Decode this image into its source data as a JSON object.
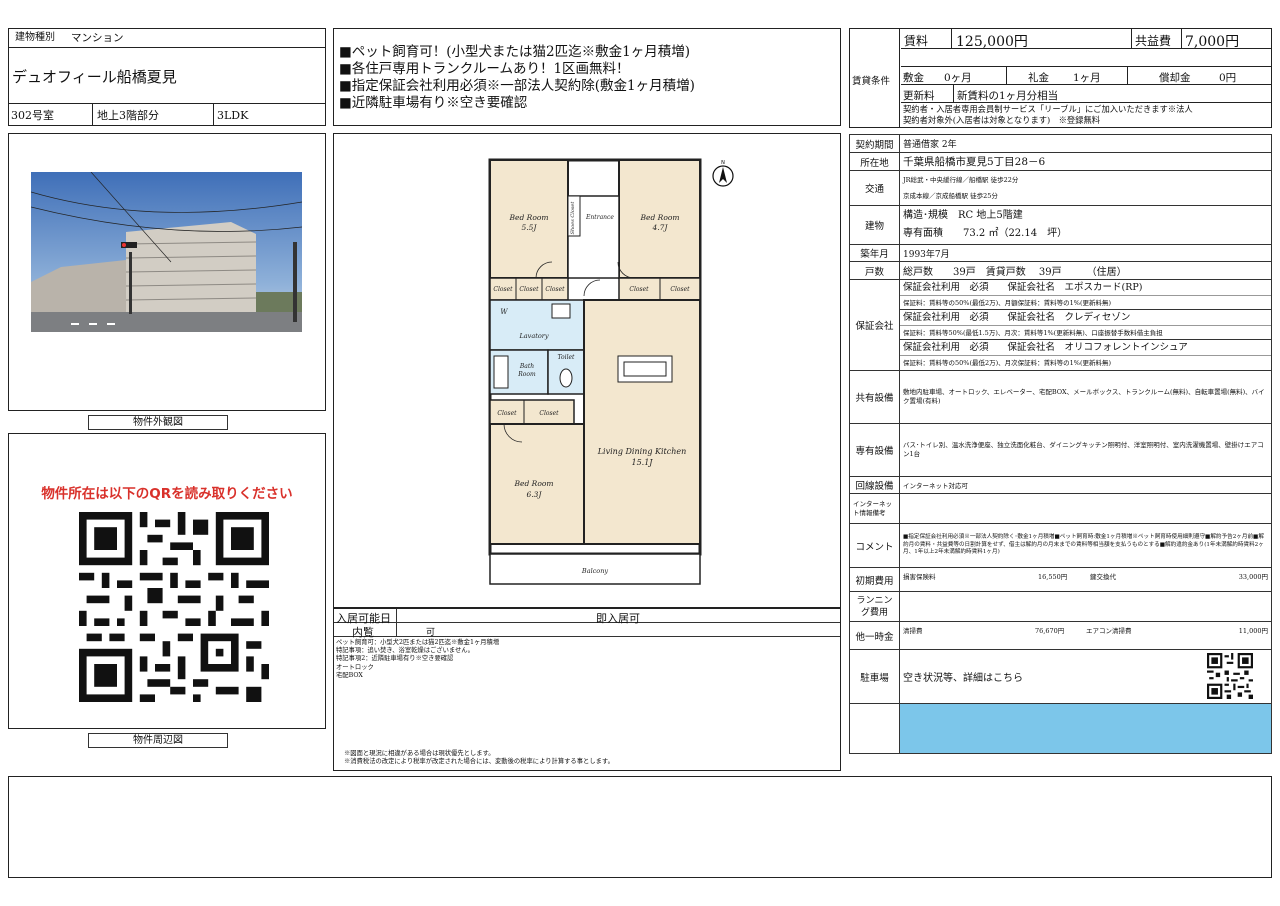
{
  "property": {
    "type_label": "建物種別",
    "type_value": "マンション",
    "name": "デュオフィール船橋夏見",
    "room": "302号室",
    "floor": "地上3階部分",
    "layout": "3LDK"
  },
  "captions": {
    "photo": "物件外観図",
    "map": "物件周辺図"
  },
  "qr_notice": "物件所在は以下のQRを読み取りください",
  "remarks": [
    "■ペット飼育可！(小型犬または猫2匹迄※敷金1ヶ月積増)",
    "■各住戸専用トランクルームあり！1区画無料！",
    "■指定保証会社利用必須※一部法人契約除(敷金1ヶ月積増)",
    "■近隣駐車場有り※空き要確認"
  ],
  "floorplan": {
    "rooms": {
      "bed1": "Bed Room\n5.5J",
      "bed2": "Bed Room\n4.7J",
      "bed3": "Bed Room\n6.3J",
      "ldk": "Living Dining Kitchen\n15.1J",
      "entrance": "Entrance",
      "shoes": "Shoes Closet",
      "lavatory": "Lavatory",
      "bath": "Bath Room",
      "toilet": "Toilet",
      "closet": "Closet",
      "balcony": "Balcony",
      "w": "W"
    }
  },
  "movein": {
    "label": "入居可能日",
    "value": "即入居可",
    "viewing_label": "内覧",
    "viewing_value": "可",
    "notes": [
      "ペット飼育可：小型犬2匹または猫2匹迄※敷金1ヶ月積増",
      "特記事項：追い焚き、浴室乾燥はございません。",
      "特記事項2：近隣駐車場有り※空き要確認",
      "オートロック",
      "宅配BOX"
    ],
    "footnotes": [
      "※図面と現況に相違がある場合は現状優先とします。",
      "※消費税法の改定により税率が改定された場合には、変動後の税率により計算する事とします。"
    ]
  },
  "rent": {
    "header": "賃貸条件",
    "rent_label": "賃料",
    "rent_value": "125,000円",
    "common_label": "共益費",
    "common_value": "7,000円",
    "deposit_label": "敷金",
    "deposit_value": "0ヶ月",
    "key_label": "礼金",
    "key_value": "1ヶ月",
    "amort_label": "償却金",
    "amort_value": "0円",
    "renewal_label": "更新料",
    "renewal_value": "新賃料の1ヶ月分相当",
    "note1": "契約者・入居者専用会員制サービス「リーブル」にご加入いただきます※法人",
    "note2": "契約者対象外(入居者は対象となります)　※登録無料"
  },
  "details": {
    "contract_label": "契約期間",
    "contract_value": "普通借家 2年",
    "address_label": "所在地",
    "address_value": "千葉県船橋市夏見5丁目28－6",
    "transport_label": "交通",
    "transport_1": "JR総武・中央緩行線／船橋駅 徒歩22分",
    "transport_2": "京成本線／京成船橋駅 徒歩25分",
    "building_label": "建物",
    "building_struct": "構造･規模　RC 地上5階建",
    "building_area": "専有面積　　73.2 ㎡（22.14　坪）",
    "built_label": "築年月",
    "built_value": "1993年7月",
    "units_label": "戸数",
    "units_value": "総戸数　　39戸　賃貸戸数　 39戸　　　（住居）",
    "guarantor_label": "保証会社",
    "g1": "保証会社利用　必須　　保証会社名　エポスカード(RP)",
    "g1_detail": "保証料：賃料等の50%(最低2万)、月額保証料：賃料等の1%(更新料無)",
    "g2": "保証会社利用　必須　　保証会社名　クレディセゾン",
    "g2_detail": "保証料：賃料等50%(最低1.5万)、月次：賃料等1%(更新料無)、口座振替手数料借主負担",
    "g3": "保証会社利用　必須　　保証会社名　オリコフォレントインシュア",
    "g3_detail": "保証料：賃料等の50%(最低2万)、月次保証料：賃料等の1%(更新料無)",
    "shared_label": "共有設備",
    "shared_value": "敷地内駐車場、オートロック、エレベーター、宅配BOX、メールボックス、トランクルーム(無料)、自転車置場(無料)、バイク置場(有料)",
    "private_label": "専有設備",
    "private_value": "バス･トイレ別、温水洗浄便座、独立洗面化粧台、ダイニングキッチン照明付、洋室照明付、室内洗濯機置場、壁掛けエアコン1台",
    "line_label": "回線設備",
    "line_value": "インターネット対応可",
    "internet_label": "インターネット情報備考",
    "internet_value": "",
    "comment_label": "コメント",
    "comment_value": "■指定保証会社利用必須※一部法人契約除く･敷金1ヶ月積増■ペット飼育時:敷金1ヶ月積増※ペット飼育時使用細則遵守■解約予告2ヶ月前■解約月の賃料・共益費等の日割計算をせず、借主は解約月の月末までの賃料等相当額を支払うものとする■解約違約金あり(1年未満解約時賃料2ヶ月、1年以上2年未満解約時賃料1ヶ月)",
    "initial_label": "初期費用",
    "initial_item1": "損害保険料",
    "initial_amount1": "16,550円",
    "initial_item2": "鍵交換代",
    "initial_amount2": "33,000円",
    "running_label": "ランニング費用",
    "other_label": "他一時金",
    "other_item1": "清掃費",
    "other_amount1": "76,670円",
    "other_item2": "エアコン清掃費",
    "other_amount2": "11,000円",
    "parking_label": "駐車場",
    "parking_value": "空き状況等、詳細はこちら",
    "accent_color": "#7cc6ea"
  }
}
